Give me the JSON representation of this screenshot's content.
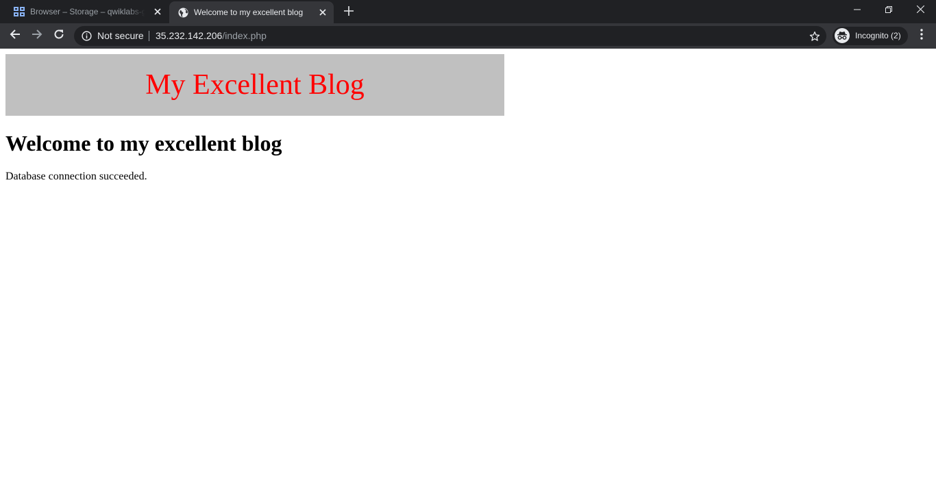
{
  "browser": {
    "tabs": [
      {
        "title": "Browser – Storage – qwiklabs-gcp",
        "favicon": "storage-grid-icon",
        "active": false
      },
      {
        "title": "Welcome to my excellent blog",
        "favicon": "globe-icon",
        "active": true
      }
    ],
    "new_tab_icon": "plus-icon",
    "window_controls": [
      "minimize-icon",
      "restore-icon",
      "close-icon"
    ],
    "omnibox": {
      "security_label": "Not secure",
      "url_host": "35.232.142.206",
      "url_path": "/index.php"
    },
    "incognito_label": "Incognito (2)",
    "colors": {
      "tabstrip_bg": "#202124",
      "toolbar_bg": "#35363a",
      "omnibox_bg": "#202124",
      "text_primary": "#e8eaed",
      "text_secondary": "#9aa0a6",
      "storage_icon": "#8ab4f8"
    }
  },
  "page": {
    "banner_title": "My Excellent Blog",
    "heading": "Welcome to my excellent blog",
    "status_message": "Database connection succeeded.",
    "colors": {
      "banner_bg": "#c0c0c0",
      "banner_text": "#ff0000",
      "body_text": "#000000"
    }
  }
}
